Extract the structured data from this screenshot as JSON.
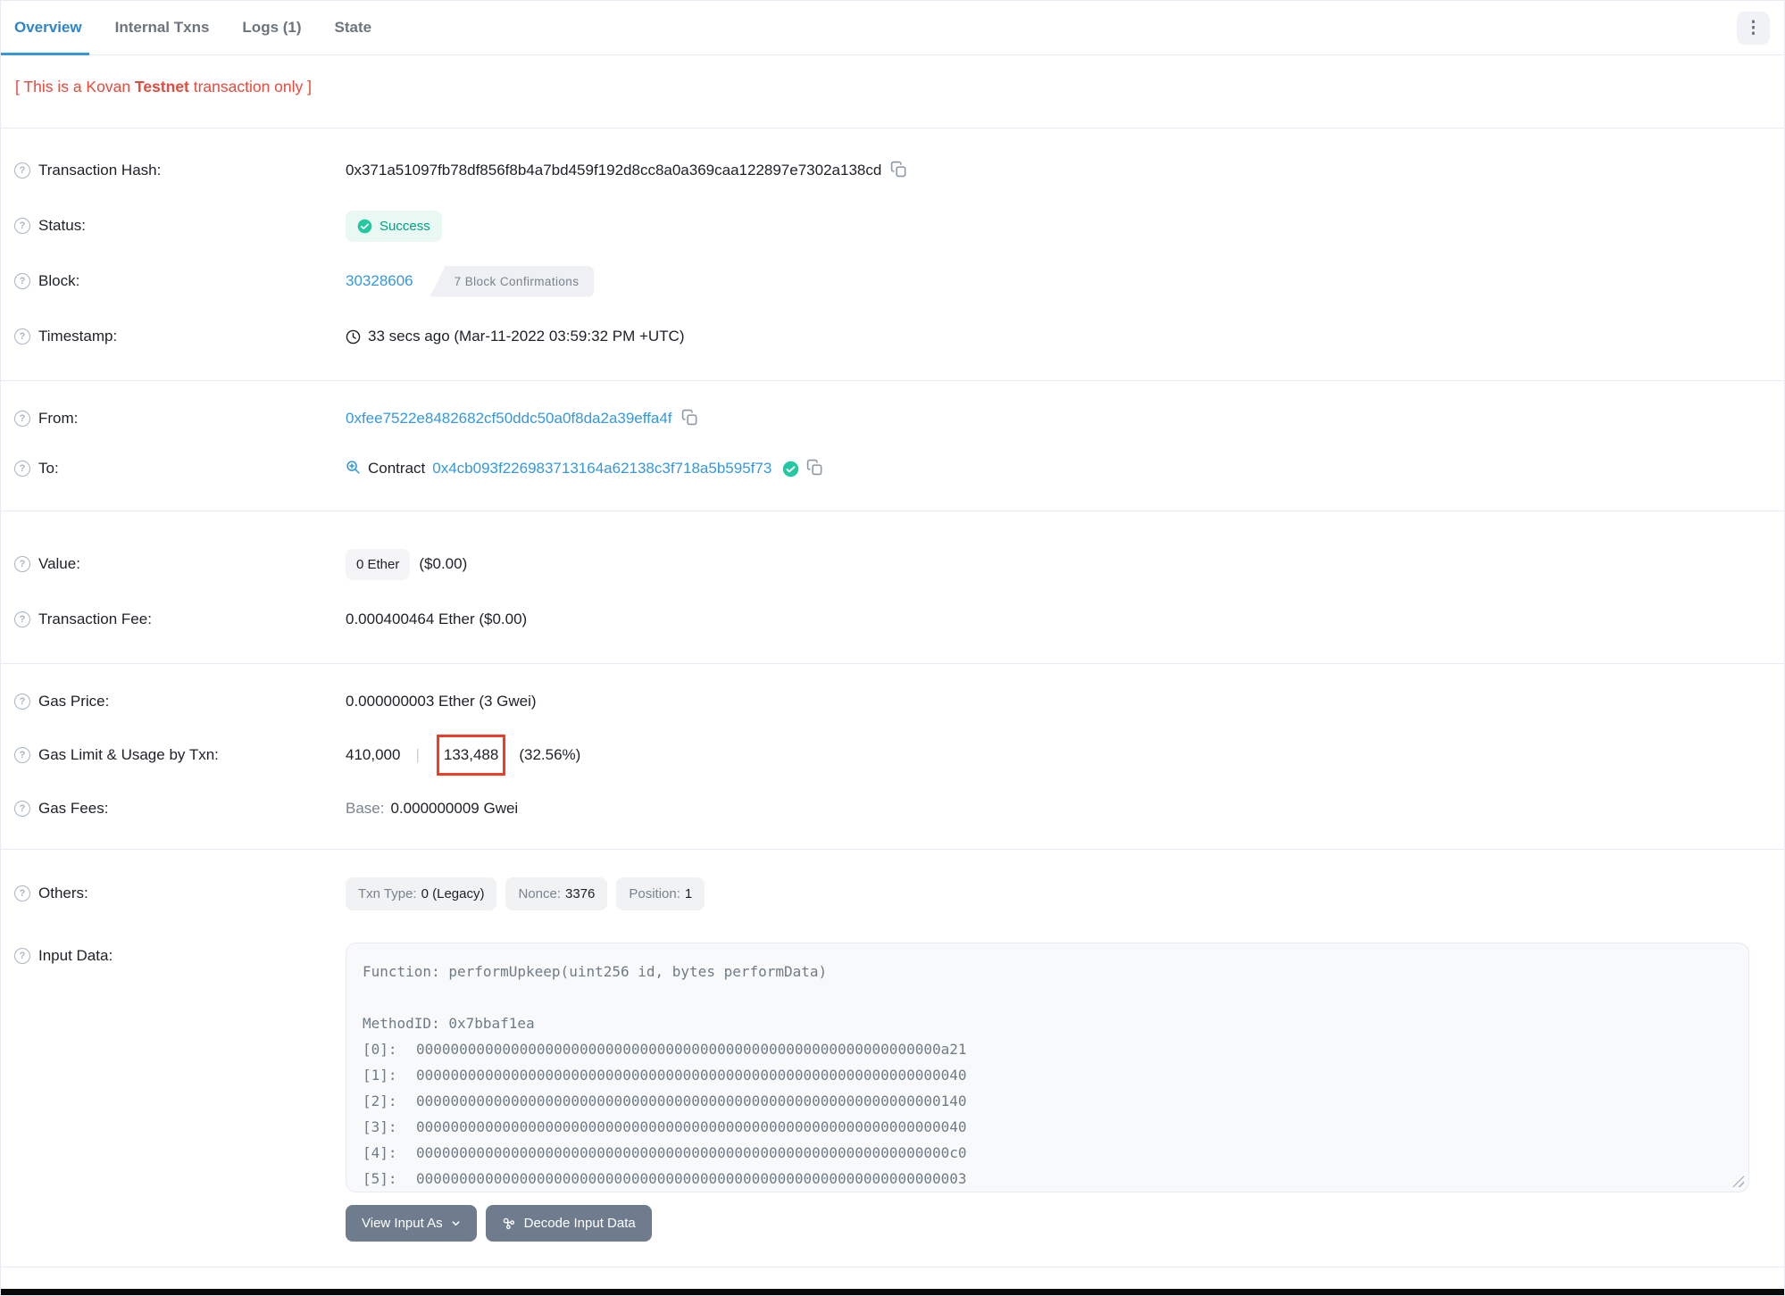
{
  "colors": {
    "accent_blue": "#3498db",
    "active_tab_blue": "#2d86c9",
    "success_teal": "#00a186",
    "success_bg": "#e9f8f2",
    "notice_red": "#e64a3c",
    "annotation_red": "#f23b26",
    "button_slate": "#6e7c8d",
    "badge_gray_bg": "#f1f2f4",
    "divider": "#e7eaf3"
  },
  "icons": {
    "help": "?",
    "kebab": "⋮"
  },
  "tabs": [
    {
      "label": "Overview"
    },
    {
      "label": "Internal Txns"
    },
    {
      "label": "Logs (1)"
    },
    {
      "label": "State"
    }
  ],
  "notice": {
    "prefix": "[ This is a Kovan ",
    "bold": "Testnet",
    "suffix": " transaction only ]"
  },
  "rows": {
    "transaction_hash": {
      "label": "Transaction Hash:",
      "value": "0x371a51097fb78df856f8b4a7bd459f192d8cc8a0a369caa122897e7302a138cd"
    },
    "status": {
      "label": "Status:",
      "value": "Success"
    },
    "block": {
      "label": "Block:",
      "number": "30328606",
      "confirmations": "7 Block Confirmations"
    },
    "timestamp": {
      "label": "Timestamp:",
      "value": "33 secs ago (Mar-11-2022 03:59:32 PM +UTC)"
    },
    "from": {
      "label": "From:",
      "address": "0xfee7522e8482682cf50ddc50a0f8da2a39effa4f"
    },
    "to": {
      "label": "To:",
      "contract_word": "Contract",
      "address": "0x4cb093f226983713164a62138c3f718a5b595f73"
    },
    "value": {
      "label": "Value:",
      "amount": "0 Ether",
      "usd": "($0.00)"
    },
    "transaction_fee": {
      "label": "Transaction Fee:",
      "value": "0.000400464 Ether ($0.00)"
    },
    "gas_price": {
      "label": "Gas Price:",
      "value": "0.000000003 Ether (3 Gwei)"
    },
    "gas_limit": {
      "label": "Gas Limit & Usage by Txn:",
      "limit": "410,000",
      "separator": "|",
      "used": "133,488",
      "percent": "(32.56%)"
    },
    "gas_fees": {
      "label": "Gas Fees:",
      "base_label": "Base:",
      "base_value": "0.000000009 Gwei"
    },
    "others": {
      "label": "Others:",
      "badges": [
        {
          "k": "Txn Type:",
          "v": "0 (Legacy)"
        },
        {
          "k": "Nonce:",
          "v": "3376"
        },
        {
          "k": "Position:",
          "v": "1"
        }
      ]
    },
    "input_data": {
      "label": "Input Data:",
      "function_line": "Function: performUpkeep(uint256 id, bytes performData)",
      "method_line": "MethodID: 0x7bbaf1ea",
      "words": [
        {
          "idx": "[0]:",
          "hex": "0000000000000000000000000000000000000000000000000000000000000a21"
        },
        {
          "idx": "[1]:",
          "hex": "0000000000000000000000000000000000000000000000000000000000000040"
        },
        {
          "idx": "[2]:",
          "hex": "0000000000000000000000000000000000000000000000000000000000000140"
        },
        {
          "idx": "[3]:",
          "hex": "0000000000000000000000000000000000000000000000000000000000000040"
        },
        {
          "idx": "[4]:",
          "hex": "00000000000000000000000000000000000000000000000000000000000000c0"
        },
        {
          "idx": "[5]:",
          "hex": "0000000000000000000000000000000000000000000000000000000000000003"
        }
      ]
    }
  },
  "buttons": {
    "view_input_as": "View Input As",
    "decode": "Decode Input Data"
  }
}
